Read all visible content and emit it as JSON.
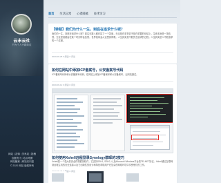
{
  "sidebar": {
    "site_name": "云末云社",
    "site_desc": "只为个人兴趣效应",
    "links": [
      "网站 | 友情 | 关系站 | 投稿",
      "百度统计 | 站点地图",
      "网站备案 | 网站访问量",
      "© 2020 网站 版权所有"
    ]
  },
  "nav": {
    "items": [
      "首页",
      "生活日常",
      "心得随笔",
      "技术学习"
    ]
  },
  "posts": [
    {
      "title": "【转载】我们为什么一生，到底在追求什么呢？",
      "excerpt": "我们的一生，到底在追求什么呢？其实无数人都在探了一个答案，无论是在求事情不是在重要的领域上，生命本身是一场告别，无论是谁都会在某个时刻学会告别，世界就将会从这里到得教。人生其实是不断的去追求的过程，人生其实是人不断追求的一个过程。",
      "meta": "2020-06-25 0 阅读 0 评论"
    },
    {
      "title": "如何在网站中添加ICP备案号，公安备案号代码",
      "excerpt": "ICP备案号代码和公安备案号代码，在网站上添加ICP备案号和公安备案号，让网站通过。",
      "meta": "2020-06-12 0 阅读 0 评论"
    },
    {
      "title": "如何使用Xshell远程登录Synology群晖的3技巧",
      "excerpt": "Xshell是一个强大的安全终端模拟软件，它支持SSH1, SSH2, 以及Microsoft Windows平台的TELNET协议。Xshell通过互联网到远程主机的安全连接以及它创新性的设计和特色帮助用户在复杂的网络环境中享受他们的工作。",
      "meta": "2020-05-26 0 阅读 0 评论"
    }
  ],
  "colors": {
    "accent": "#1a6fb0",
    "sidebar_bg": "#1b2a3a",
    "page_bg": "#e8edf2",
    "highlight_box": "#e0302a"
  }
}
